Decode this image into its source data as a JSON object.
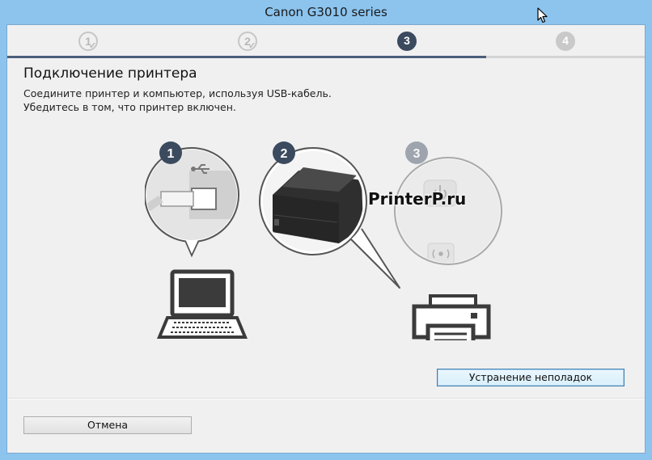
{
  "window": {
    "title": "Canon G3010 series"
  },
  "steps": [
    {
      "label": "1",
      "state": "done"
    },
    {
      "label": "2",
      "state": "done"
    },
    {
      "label": "3",
      "state": "active"
    },
    {
      "label": "4",
      "state": "future"
    }
  ],
  "page": {
    "heading": "Подключение принтера",
    "line1": "Соедините принтер и компьютер, используя USB-кабель.",
    "line2": "Убедитесь в том, что принтер включен."
  },
  "illustration": {
    "callout1": "1",
    "callout2": "2",
    "callout3": "3",
    "icons": [
      "usb-icon",
      "printer-photo",
      "power-icon",
      "wifi-icon",
      "laptop-icon",
      "printer-icon"
    ]
  },
  "watermark": "PrinterP.ru",
  "buttons": {
    "troubleshoot": "Устранение неполадок",
    "cancel": "Отмена"
  },
  "colors": {
    "accent": "#3b4a5e",
    "progress": "#4a5f7a",
    "chrome": "#8cc4ee"
  }
}
